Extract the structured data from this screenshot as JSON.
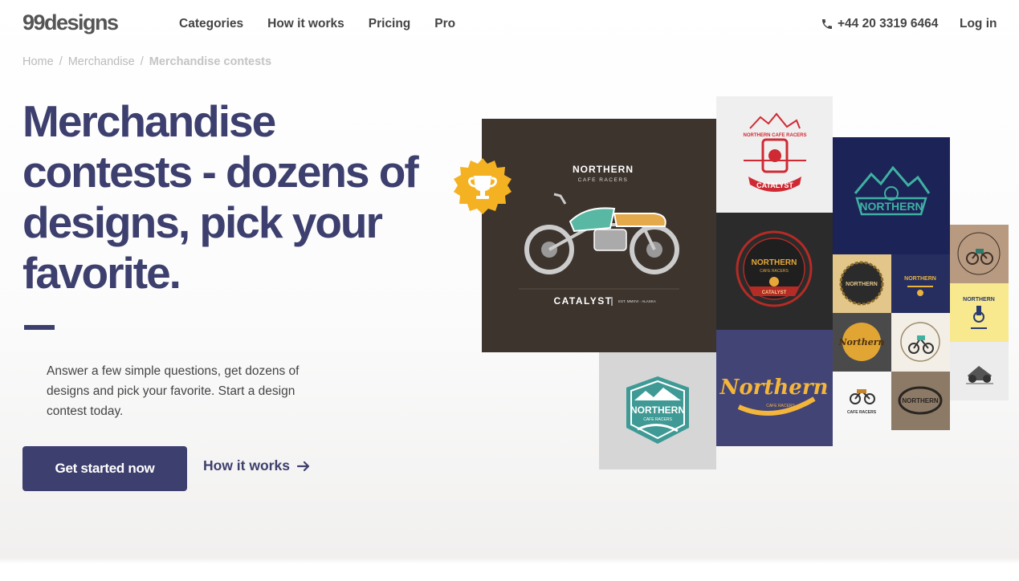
{
  "nav": {
    "logo": "99designs",
    "links": [
      "Categories",
      "How it works",
      "Pricing",
      "Pro"
    ],
    "phone": "+44 20 3319 6464",
    "login": "Log in"
  },
  "breadcrumb": {
    "items": [
      "Home",
      "Merchandise",
      "Merchandise contests"
    ],
    "separator": "/"
  },
  "hero": {
    "title": "Merchandise contests - dozens of designs, pick your favorite.",
    "description": "Answer a few simple questions, get dozens of designs and pick your favorite. Start a design contest today.",
    "cta_label": "Get started now",
    "secondary_link": "How it works"
  },
  "gallery": {
    "main_tile": {
      "brand": "NORTHERN",
      "sub": "CAFE RACERS",
      "footer_name": "CATALYST",
      "footer_tag": "EST. MMXVI · ALASKA"
    },
    "badge_icon": "trophy-icon",
    "tiles": [
      {
        "name": "red-catalyst-logo",
        "top_text": "NORTHERN CAFE RACERS",
        "bottom_text": "CATALYST",
        "bg": "#efefef"
      },
      {
        "name": "navy-mountain-logo",
        "text": "NORTHERN",
        "bg": "#1c2356"
      },
      {
        "name": "dark-seal-logo",
        "text": "NORTHERN",
        "sub": "CAFE RACERS",
        "ribbon": "CATALYST",
        "bg": "#2b2b2b"
      },
      {
        "name": "script-logo",
        "text": "Northern",
        "sub": "CAFE RACERS",
        "bg": "#424476"
      },
      {
        "name": "teal-badge-logo",
        "text": "NORTHERN",
        "sub": "CAFE RACERS",
        "bg": "#d6d6d6"
      }
    ],
    "small_tiles": [
      {
        "name": "tan-moto-logo",
        "bg": "#b89a80"
      },
      {
        "name": "yellow-moto-logo",
        "text": "NORTHERN",
        "bg": "#f8e88e"
      },
      {
        "name": "grey-moto-logo",
        "bg": "#ececec"
      },
      {
        "name": "gold-gear-logo",
        "text": "NORTHERN",
        "bg": "#e2c68a"
      },
      {
        "name": "navy-small-logo",
        "text": "NORTHERN",
        "bg": "#262e60"
      },
      {
        "name": "gold-script-logo",
        "text": "Northern",
        "bg": "#4a4a4a"
      },
      {
        "name": "cream-moto-logo",
        "bg": "#f4efe6"
      },
      {
        "name": "white-moto-logo",
        "text": "CAFE RACERS",
        "bg": "#f7f7f7"
      },
      {
        "name": "brown-oval-logo",
        "text": "NORTHERN",
        "bg": "#8c7a67"
      }
    ]
  }
}
